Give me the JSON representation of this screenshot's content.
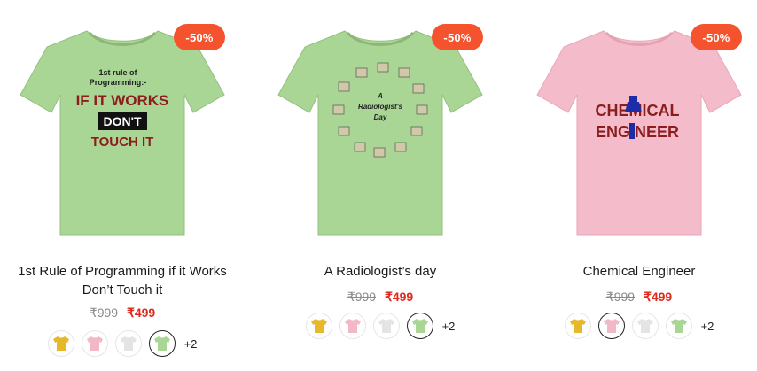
{
  "products": [
    {
      "discount": "-50%",
      "title": "1st Rule of Programming if it Works Don’t Touch it",
      "old_price": "₹999",
      "new_price": "₹499",
      "shirt_color": "#a9d595",
      "print": {
        "line1": "1st rule of",
        "line2": "Programming:-",
        "line3": "IF IT WORKS",
        "line4": "DON'T",
        "line5": "TOUCH IT"
      },
      "swatches": [
        {
          "color": "#e6b82a",
          "name": "yellow"
        },
        {
          "color": "#f3b8c8",
          "name": "pink"
        },
        {
          "color": "#e4e4e4",
          "name": "white"
        },
        {
          "color": "#a9d595",
          "name": "green",
          "selected": true
        }
      ],
      "more": "+2"
    },
    {
      "discount": "-50%",
      "title": "A Radiologist’s day",
      "old_price": "₹999",
      "new_price": "₹499",
      "shirt_color": "#a9d595",
      "print": {
        "line1": "A",
        "line2": "Radiologist's",
        "line3": "Day"
      },
      "swatches": [
        {
          "color": "#e6b82a",
          "name": "yellow"
        },
        {
          "color": "#f3b8c8",
          "name": "pink"
        },
        {
          "color": "#e4e4e4",
          "name": "white"
        },
        {
          "color": "#a9d595",
          "name": "green",
          "selected": true
        }
      ],
      "more": "+2"
    },
    {
      "discount": "-50%",
      "title": "Chemical Engineer",
      "old_price": "₹999",
      "new_price": "₹499",
      "shirt_color": "#f4bccb",
      "print": {
        "line1": "CHEMICAL",
        "line2": "ENGINEER"
      },
      "swatches": [
        {
          "color": "#e6b82a",
          "name": "yellow"
        },
        {
          "color": "#f3b8c8",
          "name": "pink",
          "selected": true
        },
        {
          "color": "#e4e4e4",
          "name": "white"
        },
        {
          "color": "#a9d595",
          "name": "green"
        }
      ],
      "more": "+2"
    }
  ]
}
